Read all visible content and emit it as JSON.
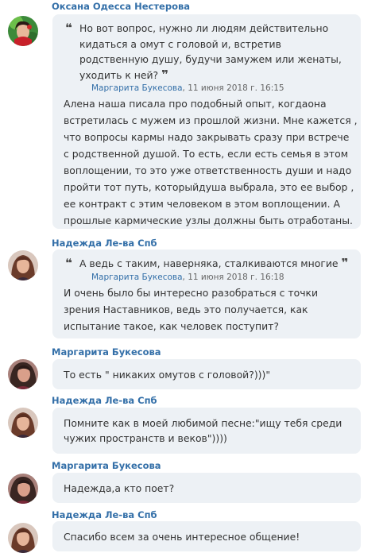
{
  "messages": [
    {
      "author": "Оксана Одесса Нестерова",
      "quote": {
        "lines": [
          "Но вот вопрос, нужно ли людям действительно",
          "кидаться а омут с головой и, встретив",
          "родственную душу, будучи замужем или женаты,",
          "уходить к ней?"
        ],
        "author": "Маргарита Букесова",
        "date": ", 11 июня 2018 г. 16:15"
      },
      "lines": [
        "Алена наша писала про подобный опыт, когдаона",
        "встретилась с мужем из прошлой жизни. Мне кажется ,",
        "что вопросы кармы надо закрывать сразу при встрече",
        "с родственной душой. То есть, если есть семья в этом",
        "воплощении, то это уже ответственность души и надо",
        "пройти тот путь, которыйдуша выбрала, это ее выбор ,",
        "ее контракт с этим человеком в этом воплощении. А",
        "прошлые кармические узлы должны быть отработаны."
      ]
    },
    {
      "author": "Надежда Ле-ва Спб",
      "quote": {
        "lines": [
          "А ведь с таким, наверняка, сталкиваются многие"
        ],
        "author": "Маргарита Букесова",
        "date": ", 11 июня 2018 г. 16:18"
      },
      "lines": [
        "И очень было бы интересно разобраться с точки",
        "зрения Наставников, ведь это получается, как",
        "испытание такое, как человек поступит?"
      ]
    },
    {
      "author": "Маргарита Букесова",
      "lines": [
        "То есть \" никаких омутов с головой?)))\""
      ]
    },
    {
      "author": "Надежда Ле-ва Спб",
      "lines": [
        "Помните как в моей любимой песне:\"ищу тебя среди",
        "чужих пространств и веков\"))))"
      ]
    },
    {
      "author": "Маргарита Букесова",
      "lines": [
        "Надежда,а кто поет?"
      ]
    },
    {
      "author": "Надежда Ле-ва Спб",
      "lines": [
        "Спасибо всем за очень интересное общение!"
      ]
    }
  ],
  "quote_open": "❝",
  "quote_close": "❞",
  "colors": {
    "author": "#336fa8",
    "bubble": "#edf1f5",
    "text": "#333333"
  }
}
